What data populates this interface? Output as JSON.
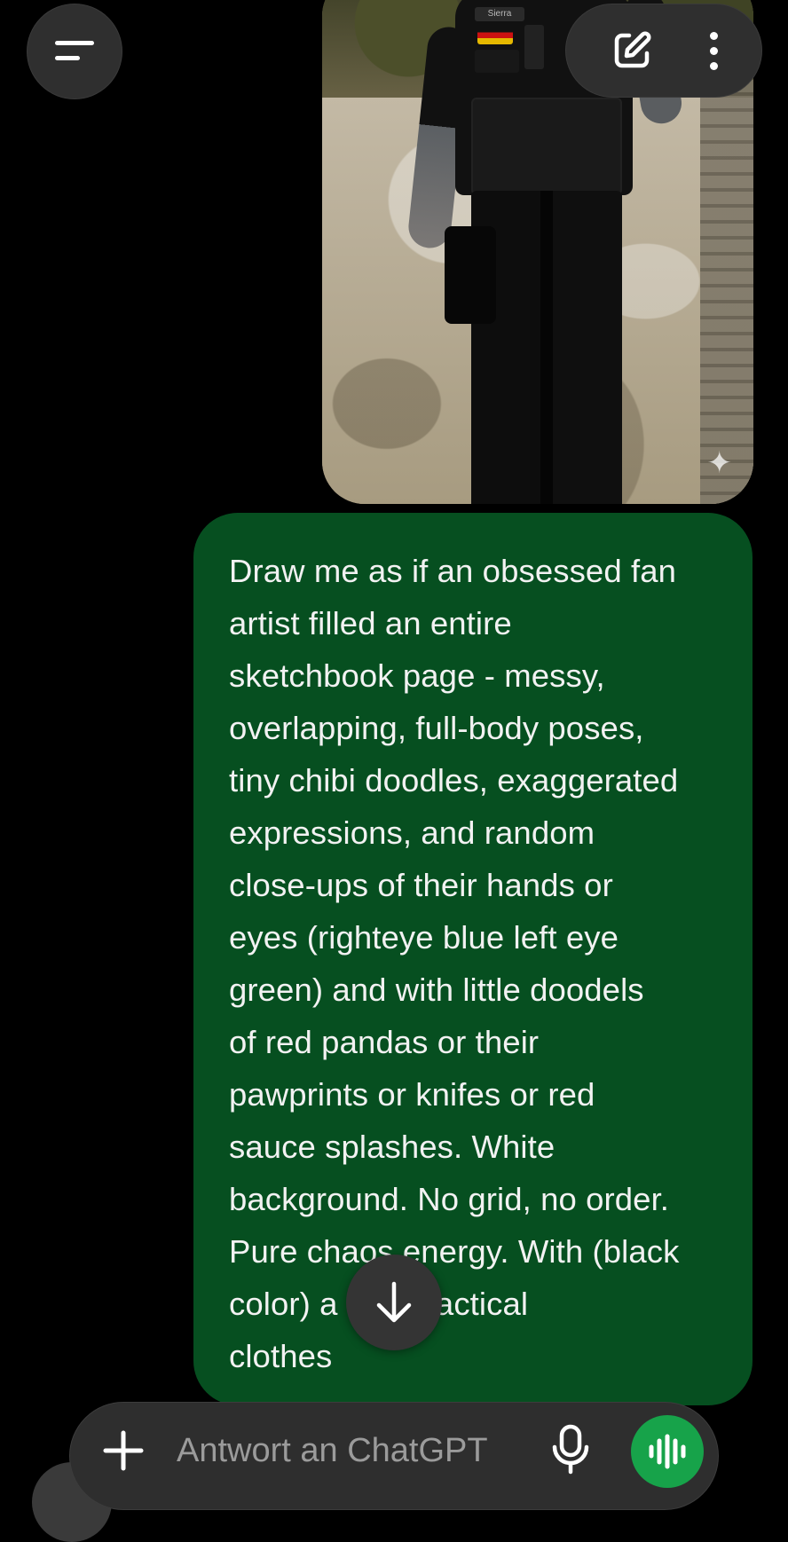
{
  "photo": {
    "patch_name": "Sierra"
  },
  "message": {
    "text": "Draw me as if an obsessed fan\nartist filled an entire\nsketchbook page - messy,\noverlapping, full-body poses,\ntiny chibi doodles, exaggerated\nexpressions, and random\nclose-ups of their hands or\neyes (righteye blue left eye\ngreen) and with little doodels\nof red pandas or their\npawprints or knifes or red\nsauce splashes. White\nbackground. No grid, no order.\nPure chaos energy. With (black\ncolor) a                 tic or tactical\nclothes"
  },
  "composer": {
    "placeholder": "Antwort an ChatGPT"
  },
  "icons": {
    "menu": "menu-icon",
    "new_chat": "edit-icon",
    "more": "more-vertical-icon",
    "scroll": "arrow-down-icon",
    "add": "plus-icon",
    "mic": "microphone-icon",
    "voice": "voice-waveform-icon"
  },
  "colors": {
    "background": "#000000",
    "bubble": "#064f20",
    "voice_button": "#17a34a"
  }
}
